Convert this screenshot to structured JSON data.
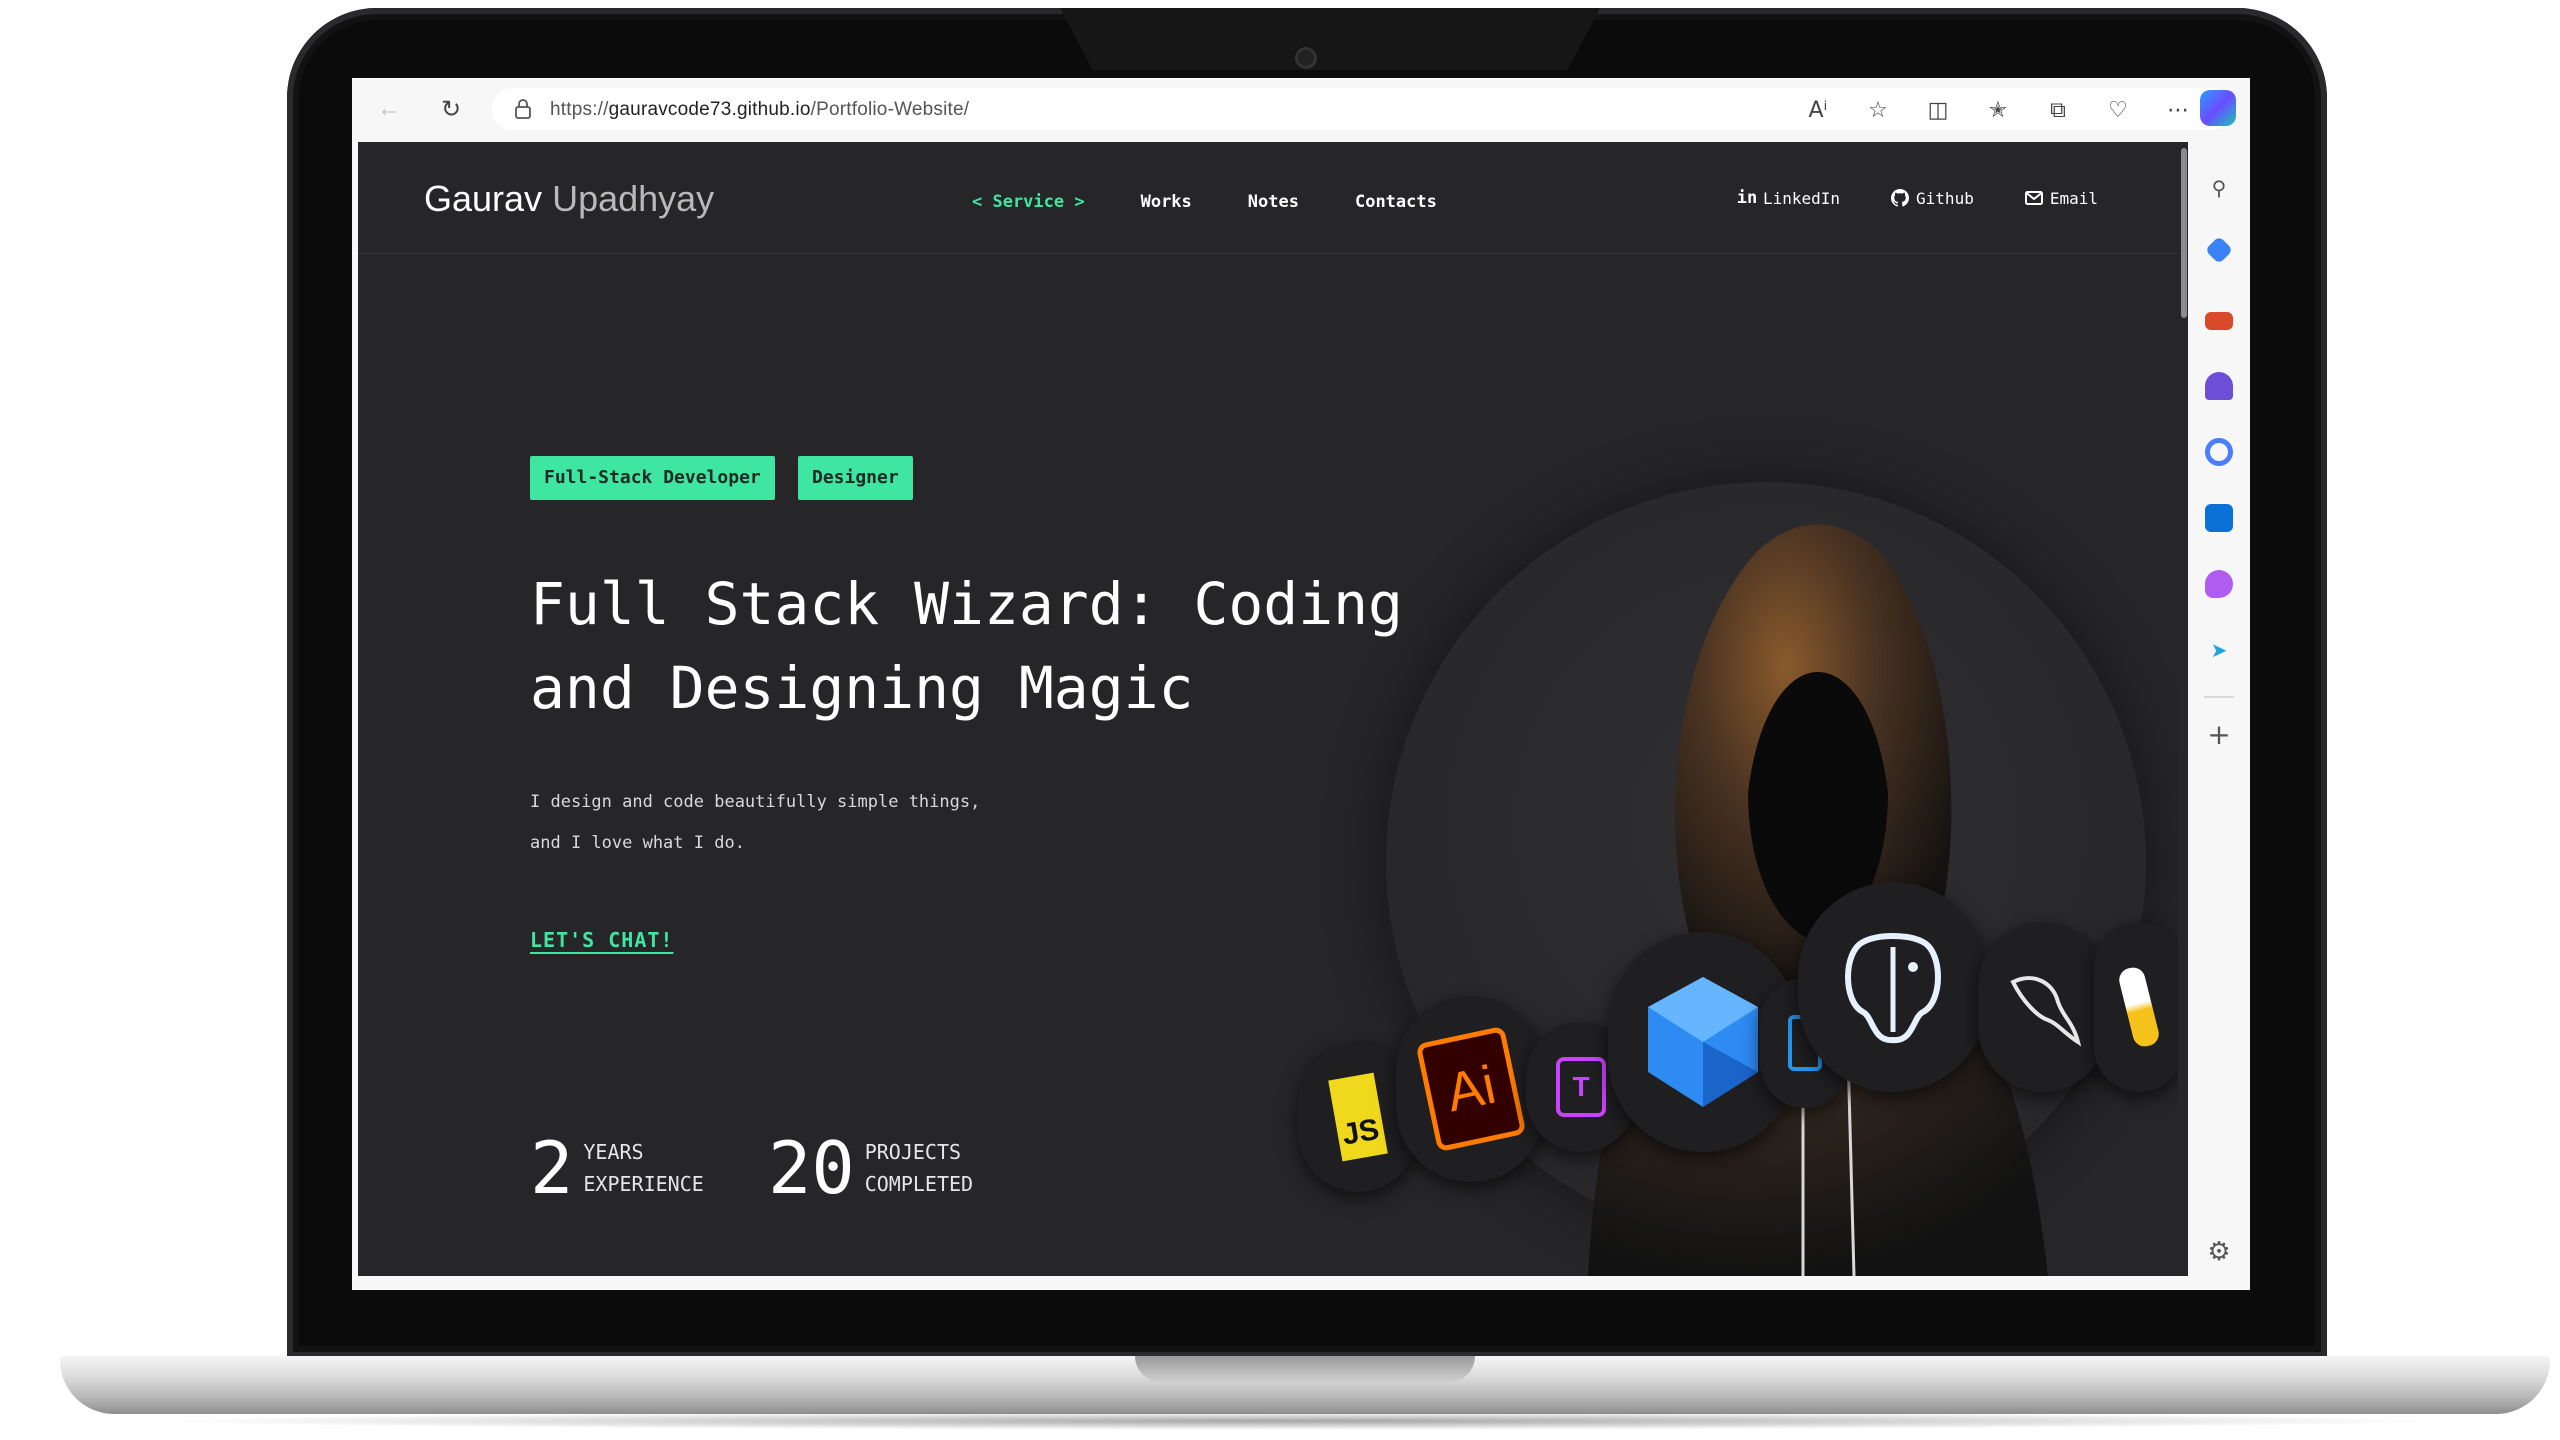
{
  "browser": {
    "url_scheme": "https://",
    "url_host": "gauravcode73.github.io",
    "url_path": "/Portfolio-Website/",
    "toolbar_icons": [
      "read-aloud-icon",
      "favorite-star-icon",
      "split-screen-icon",
      "favorites-icon",
      "collections-icon",
      "browser-essentials-icon",
      "more-icon",
      "copilot-icon"
    ],
    "sidebar_icons": [
      "search-icon",
      "shopping-tag-icon",
      "tools-icon",
      "games-icon",
      "copilot-ring-icon",
      "outlook-icon",
      "drop-icon",
      "send-icon",
      "add-icon",
      "settings-icon"
    ]
  },
  "site": {
    "brand_first": "Gaurav",
    "brand_last": "Upadhyay",
    "nav": [
      {
        "label": "< Service >",
        "active": true
      },
      {
        "label": "Works",
        "active": false
      },
      {
        "label": "Notes",
        "active": false
      },
      {
        "label": "Contacts",
        "active": false
      }
    ],
    "social": [
      {
        "label": "LinkedIn",
        "icon": "linkedin-icon"
      },
      {
        "label": "Github",
        "icon": "github-icon"
      },
      {
        "label": "Email",
        "icon": "email-icon"
      }
    ]
  },
  "hero": {
    "tags": [
      "Full-Stack Developer",
      "Designer"
    ],
    "headline_line1": "Full Stack Wizard: Coding",
    "headline_line2": "and Designing Magic",
    "subtext_line1": "I design and code beautifully simple things,",
    "subtext_line2": "and I love what I do.",
    "cta": "LET'S CHAT!",
    "stats": [
      {
        "number": "2",
        "label_line1": "YEARS",
        "label_line2": "EXPERIENCE"
      },
      {
        "number": "20",
        "label_line1": "PROJECTS",
        "label_line2": "COMPLETED"
      }
    ],
    "tech_icons": [
      "javascript-icon",
      "illustrator-icon",
      "tailwind-icon",
      "dart-icon",
      "docker-icon",
      "postgresql-icon",
      "mysql-icon",
      "python-icon"
    ],
    "tech_labels": {
      "javascript": "JS",
      "illustrator": "Ai",
      "tailwind": "T"
    }
  },
  "colors": {
    "accent": "#3ee6a2",
    "page_bg": "#262628",
    "text": "#ffffff"
  }
}
